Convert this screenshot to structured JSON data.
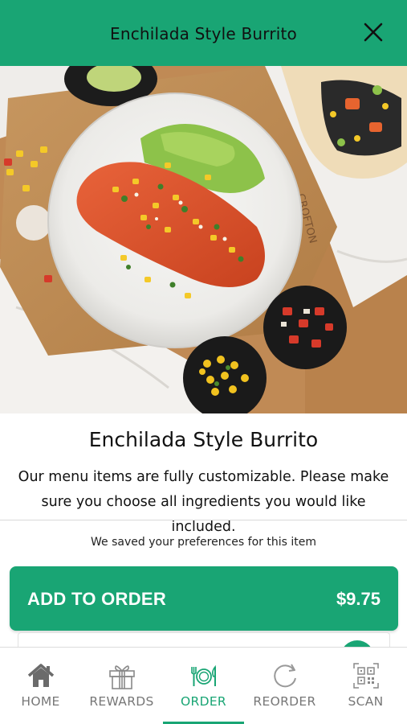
{
  "header": {
    "title": "Enchilada Style Burrito",
    "background": "#19a574",
    "close_icon": "close-icon"
  },
  "hero": {
    "board_text": "CROFTON"
  },
  "item": {
    "title": "Enchilada Style Burrito",
    "description": "Our menu items are fully customizable. Please make sure you choose all ingredients you would like included.",
    "saved_note": "We saved your preferences for this item"
  },
  "add_to_order": {
    "label": "ADD TO ORDER",
    "price": "$9.75",
    "color": "#19a574"
  },
  "tabbar": {
    "active": "ORDER",
    "active_color": "#19a574",
    "inactive_color": "#777777",
    "tabs": [
      {
        "label": "HOME",
        "icon": "home-icon"
      },
      {
        "label": "REWARDS",
        "icon": "gift-icon"
      },
      {
        "label": "ORDER",
        "icon": "utensils-plate-icon"
      },
      {
        "label": "REORDER",
        "icon": "refresh-icon"
      },
      {
        "label": "SCAN",
        "icon": "qr-code-icon"
      }
    ]
  }
}
